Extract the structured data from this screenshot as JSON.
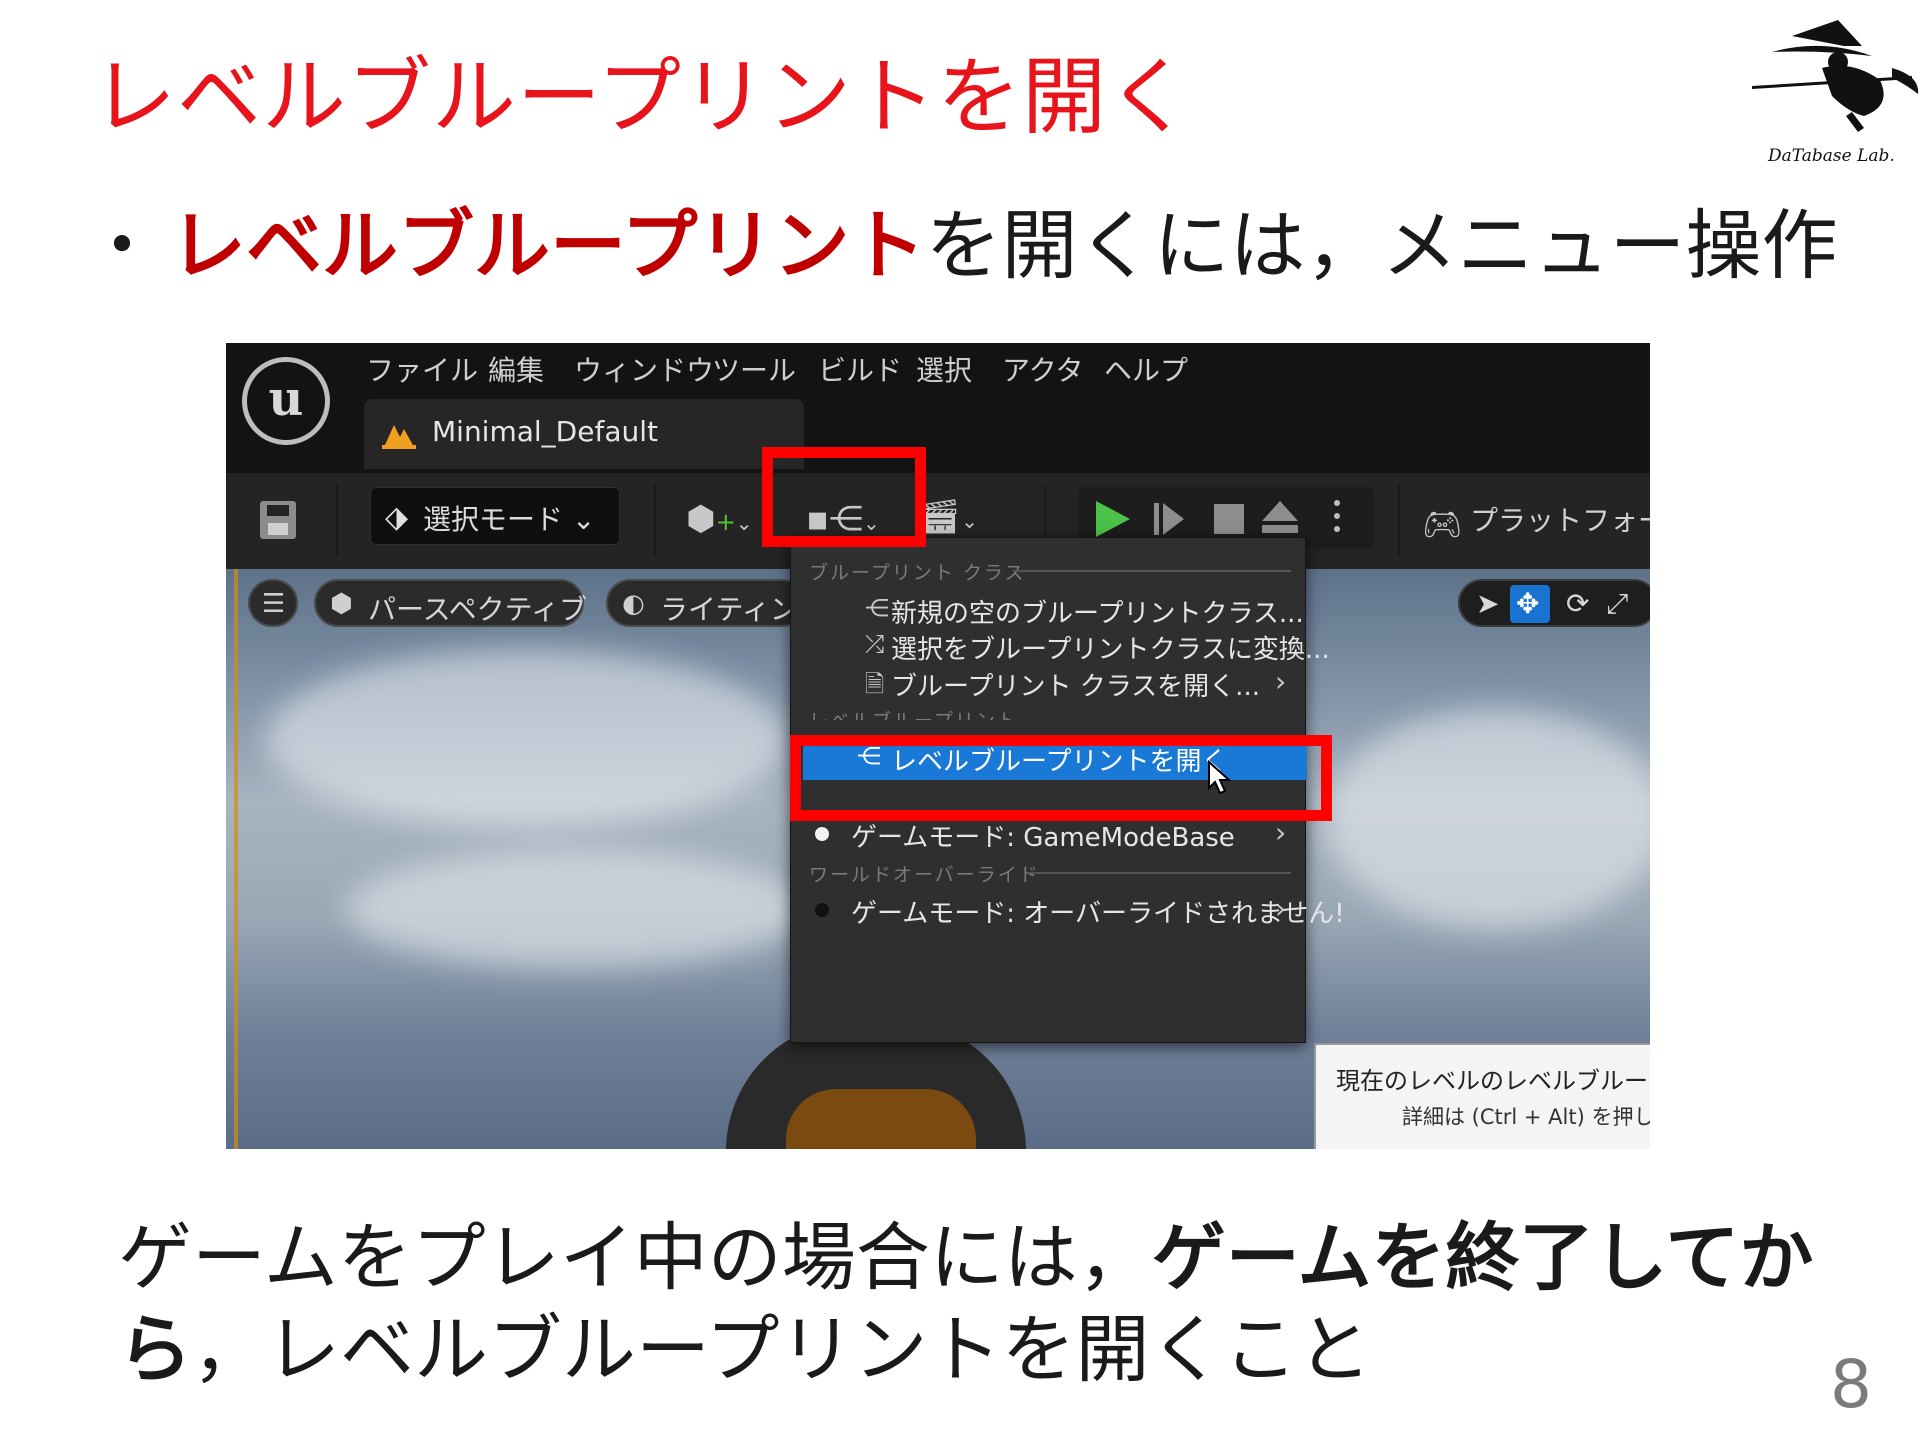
{
  "slide": {
    "title": "レベルブループリントを開く",
    "bullet_dot": "・",
    "bullet_highlight": "レベルブループリント",
    "bullet_rest": "を開くには，メニュー操作",
    "caption_line1_a": "ゲームをプレイ中の場合には，",
    "caption_line1_b": "ゲームを終了してか",
    "caption_line2_a": "ら",
    "caption_line2_b": "，レベルブループリントを開くこと",
    "page_number": "8",
    "logo_text": "DaTabase Lab.",
    "colors": {
      "title": "#e8141b",
      "highlight": "#c00000",
      "annotation_box": "#ff0000"
    }
  },
  "editor": {
    "logo_glyph": "u",
    "menu": [
      "ファイル",
      "編集",
      "ウィンドウ",
      "ツール",
      "ビルド",
      "選択",
      "アクタ",
      "ヘルプ"
    ],
    "document_tab": "Minimal_Default",
    "toolbar": {
      "mode_label": "選択モード",
      "chevron": "⌄",
      "platform_label": "プラットフォー"
    },
    "viewport": {
      "perspective_label": "パースペクティブ",
      "lighting_label": "ライティン",
      "tooltip_line1": "現在のレベルのレベルブルー",
      "tooltip_line2": "詳細は (Ctrl + Alt) を押して"
    },
    "dropdown": {
      "section_blueprint_class": "ブループリント クラス",
      "new_class": "新規の空のブループリントクラス...",
      "convert_selection": "選択をブループリントクラスに変換...",
      "open_class": "ブループリント クラスを開く...",
      "section_level_blueprint": "レベルブループリント",
      "open_level_blueprint": "レベルブループリントを開く",
      "game_mode_project": "ゲームモード: GameModeBase",
      "section_world_override": "ワールドオーバーライド",
      "game_mode_override": "ゲームモード: オーバーライドされません!",
      "arrow": "›",
      "colors": {
        "selected": "#1a78d7",
        "play": "#4cc24a"
      }
    }
  }
}
